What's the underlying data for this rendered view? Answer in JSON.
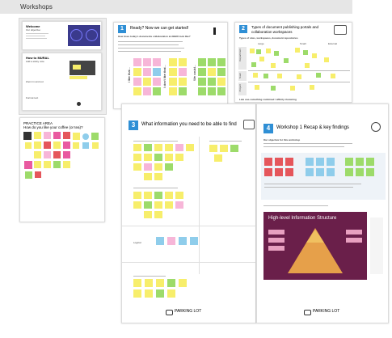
{
  "board": {
    "title": "Workshops"
  },
  "frames": {
    "welcome": {
      "title": "Welcome",
      "subtitle": "Our objective:"
    },
    "how_miro": {
      "title": "How to MURAL",
      "labels": [
        "Add a sticky note",
        "Zoom in and out",
        "Format text"
      ]
    },
    "practice": {
      "title": "PRACTICE AREA",
      "question": "How do you like your coffee (or tea)?"
    },
    "f1": {
      "number": "1",
      "title": "Ready? Now we can get started!",
      "question": "How does today's documents collaboration at ABBO look like?",
      "col_labels": [
        "I like that...",
        "I don't like that...",
        "We could..."
      ]
    },
    "f2": {
      "number": "2",
      "title": "Types of document publishing portals and collaboration workspaces",
      "subtitle": "Types of sites, workspaces, document repositories",
      "col_labels": [
        "Large",
        "Small",
        "External"
      ],
      "row_labels": [
        "Department",
        "Team",
        "Project"
      ],
      "footer": "Late use-something combined / affinity clustering"
    },
    "f3": {
      "number": "3",
      "title": "What information you need to be able to find",
      "section_label": "Logical"
    },
    "f4": {
      "number": "4",
      "title": "Workshop 1 Recap & key findings",
      "subtitle": "Our objective for this workshop",
      "pyramid_title": "High-level Information Structure"
    }
  },
  "parking": {
    "label_left": "PARKING LOT",
    "label_right": "PARKING LOT"
  },
  "colors": {
    "accent_blue": "#2f8fd5",
    "pyramid_bg": "#6a1f4a",
    "sticky_yellow": "#f7ee6b"
  }
}
